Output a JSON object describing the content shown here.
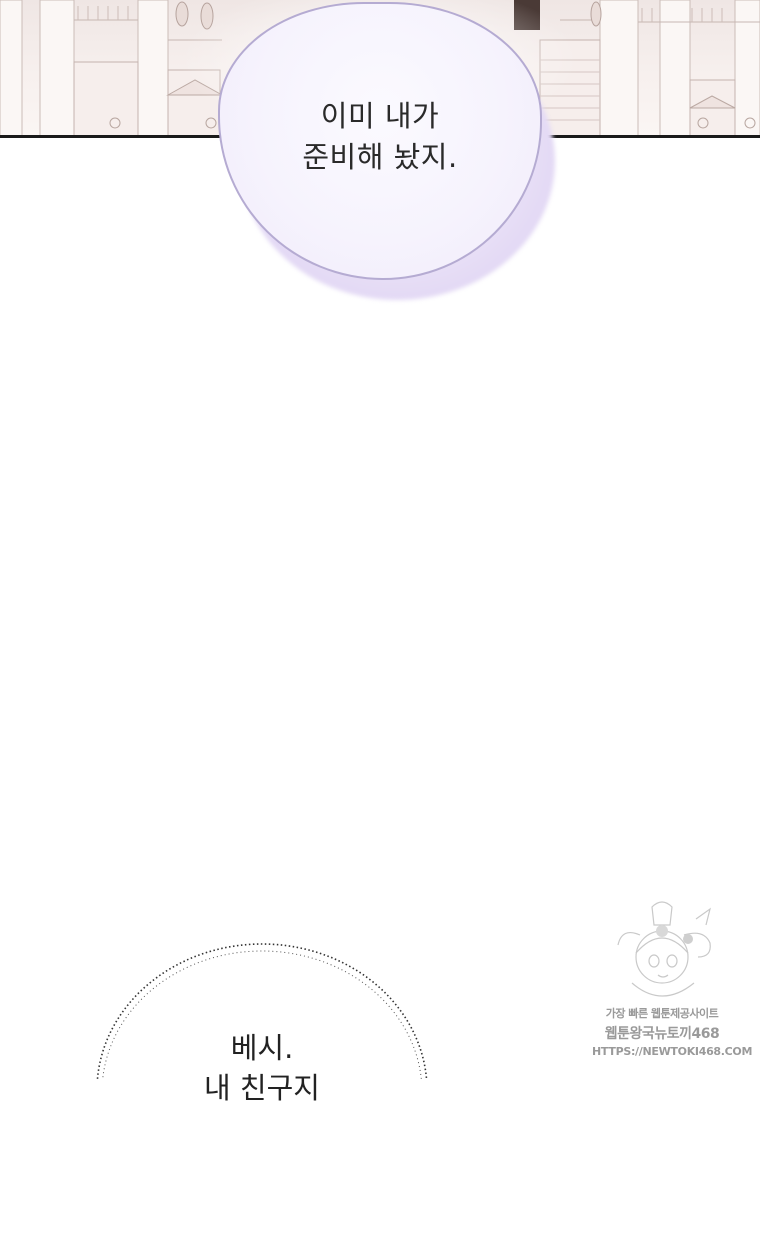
{
  "bubble_top": {
    "lines": [
      "이미 내가",
      "준비해 놨지."
    ]
  },
  "bubble_bottom": {
    "lines": [
      "베시.",
      "내 친구지"
    ]
  },
  "watermark": {
    "line1": "가장 빠른 웹툰제공사이트",
    "line2": "웹툰왕국뉴토끼468",
    "line3": "HTTPS://NEWTOKI468.COM"
  },
  "colors": {
    "bubble_border": "#b5abd2",
    "bubble_glow": "#d9ccf1",
    "panel_bg": "#f4ecea",
    "text": "#2a2a2a"
  }
}
